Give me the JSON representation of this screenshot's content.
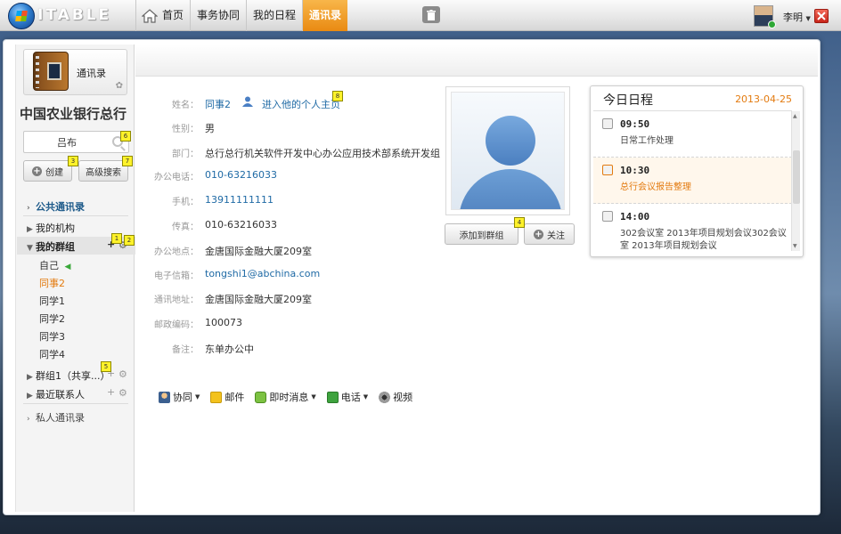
{
  "app": {
    "logo_text": "ITABLE"
  },
  "nav": {
    "home": "首页",
    "tabs": [
      "事务协同",
      "我的日程",
      "通讯录"
    ],
    "active_tab": "通讯录"
  },
  "user": {
    "name": "李明",
    "status_color": "#2ea836"
  },
  "sidebar": {
    "app_title": "通讯录",
    "org_name": "中国农业银行总行",
    "search_value": "吕布",
    "create_label": "创建",
    "advanced_search_label": "高级搜索",
    "public_contacts": "公共通讯录",
    "my_org": "我的机构",
    "my_groups": "我的群组",
    "group_members": [
      "自己",
      "同事2",
      "同学1",
      "同学2",
      "同学3",
      "同学4"
    ],
    "selected_member": "同事2",
    "group1": "群组1（共享...）",
    "recent_contacts": "最近联系人",
    "private_contacts": "私人通讯录",
    "badges": [
      "1",
      "2",
      "3",
      "5",
      "6",
      "7"
    ]
  },
  "details": {
    "labels": {
      "name": "姓名：",
      "gender": "性别：",
      "dept": "部门：",
      "office_phone": "办公电话：",
      "mobile": "手机：",
      "fax": "传真：",
      "address": "办公地点：",
      "email": "电子信箱：",
      "mail_address": "通讯地址：",
      "zip": "邮政编码：",
      "note": "备注："
    },
    "values": {
      "name": "同事2",
      "homepage_link": "进入他的个人主页",
      "gender": "男",
      "dept": "总行总行机关软件开发中心办公应用技术部系统开发组",
      "office_phone": "010-63216033",
      "mobile": "13911111111",
      "fax": "010-63216033",
      "address": "金唐国际金融大厦209室",
      "email": "tongshi1@abchina.com",
      "mail_address": "金唐国际金融大厦209室",
      "zip": "100073",
      "note": "东单办公中"
    },
    "badges": [
      "8",
      "4"
    ],
    "add_to_group": "添加到群组",
    "follow": "关注",
    "contact_bar": [
      "协同",
      "邮件",
      "即时消息",
      "电话",
      "视频"
    ]
  },
  "schedule": {
    "title": "今日日程",
    "date": "2013-04-25",
    "items": [
      {
        "time": "09:50",
        "text": "日常工作处理"
      },
      {
        "time": "10:30",
        "text": "总行会议报告整理"
      },
      {
        "time": "14:00",
        "text": "302会议室  2013年项目规划会议302会议室 2013年项目规划会议"
      }
    ],
    "highlight_color": "#e37b10"
  }
}
